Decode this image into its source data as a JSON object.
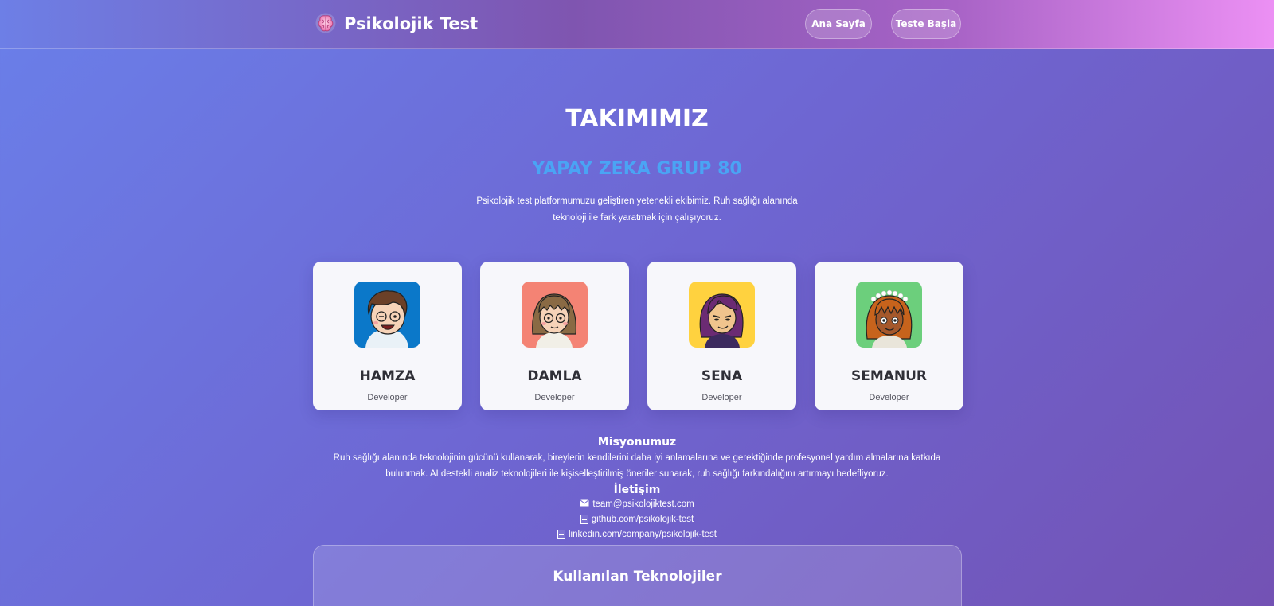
{
  "header": {
    "brand": "Psikolojik Test",
    "brand_icon": "brain-icon",
    "nav": [
      {
        "label": "Ana Sayfa"
      },
      {
        "label": "Teste Başla"
      }
    ]
  },
  "hero": {
    "title": "TAKIMIMIZ",
    "group": "YAPAY ZEKA GRUP 80",
    "intro": "Psikolojik test platformumuzu geliştiren yetenekli ekibimiz. Ruh sağlığı alanında teknoloji ile fark yaratmak için çalışıyoruz."
  },
  "team": [
    {
      "name": "HAMZA",
      "role": "Developer",
      "avatar_bg": "#0b78c9"
    },
    {
      "name": "DAMLA",
      "role": "Developer",
      "avatar_bg": "#f48374"
    },
    {
      "name": "SENA",
      "role": "Developer",
      "avatar_bg": "#ffd23f"
    },
    {
      "name": "SEMANUR",
      "role": "Developer",
      "avatar_bg": "#6ccf7c"
    }
  ],
  "mission": {
    "title": "Misyonumuz",
    "text": "Ruh sağlığı alanında teknolojinin gücünü kullanarak, bireylerin kendilerini daha iyi anlamalarına ve gerektiğinde profesyonel yardım almalarına katkıda bulunmak. AI destekli analiz teknolojileri ile kişiselleştirilmiş öneriler sunarak, ruh sağlığı farkındalığını artırmayı hedefliyoruz."
  },
  "contact": {
    "title": "İletişim",
    "email": "team@psikolojiktest.com",
    "github": "github.com/psikolojik-test",
    "linkedin": "linkedin.com/company/psikolojik-test"
  },
  "tech": {
    "title": "Kullanılan Teknolojiler"
  },
  "colors": {
    "accent": "#4aa4f4",
    "card_bg": "#f7f7fb",
    "name_text": "#2f2f37"
  }
}
